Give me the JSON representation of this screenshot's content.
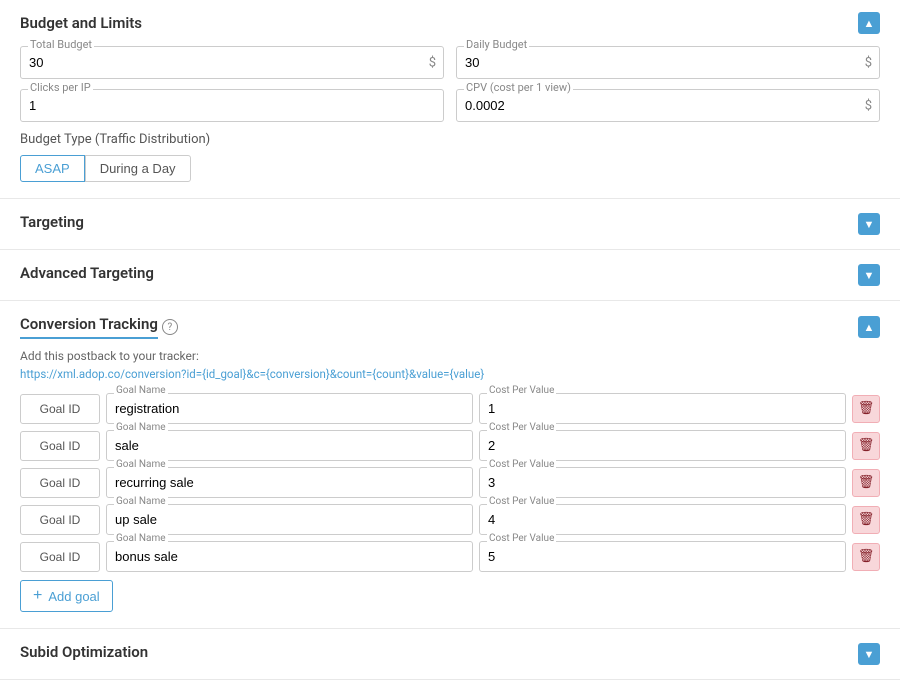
{
  "budget": {
    "title": "Budget and Limits",
    "totalBudgetLabel": "Total Budget",
    "totalBudgetValue": "30",
    "dailyBudgetLabel": "Daily Budget",
    "dailyBudgetValue": "30",
    "clicksPerIPLabel": "Clicks per IP",
    "clicksPerIPValue": "1",
    "cpvLabel": "CPV (cost per 1 view)",
    "cpvValue": "0.0002",
    "budgetTypeLabel": "Budget Type (Traffic Distribution)",
    "budgetTypes": [
      "ASAP",
      "During a Day"
    ],
    "activeBudgetType": "ASAP",
    "currencySymbol": "$"
  },
  "targeting": {
    "title": "Targeting"
  },
  "advancedTargeting": {
    "title": "Advanced Targeting"
  },
  "conversionTracking": {
    "title": "Conversion Tracking",
    "addPostbackLabel": "Add this postback to your tracker:",
    "postbackUrl": "https://xml.adop.co/conversion?id={id_goal}&c={conversion}&count={count}&value={value}",
    "goalIdLabel": "Goal ID",
    "rows": [
      {
        "goalIdBtn": "Goal ID",
        "goalNameLabel": "Goal Name",
        "goalNameValue": "registration",
        "costPerValueLabel": "Cost Per Value",
        "costPerValueValue": "1"
      },
      {
        "goalIdBtn": "Goal ID",
        "goalNameLabel": "Goal Name",
        "goalNameValue": "sale",
        "costPerValueLabel": "Cost Per Value",
        "costPerValueValue": "2"
      },
      {
        "goalIdBtn": "Goal ID",
        "goalNameLabel": "Goal Name",
        "goalNameValue": "recurring sale",
        "costPerValueLabel": "Cost Per Value",
        "costPerValueValue": "3"
      },
      {
        "goalIdBtn": "Goal ID",
        "goalNameLabel": "Goal Name",
        "goalNameValue": "up sale",
        "costPerValueLabel": "Cost Per Value",
        "costPerValueValue": "4"
      },
      {
        "goalIdBtn": "Goal ID",
        "goalNameLabel": "Goal Name",
        "goalNameValue": "bonus sale",
        "costPerValueLabel": "Cost Per Value",
        "costPerValueValue": "5"
      }
    ],
    "addGoalLabel": "Add goal"
  },
  "subidOptimization": {
    "title": "Subid Optimization"
  }
}
